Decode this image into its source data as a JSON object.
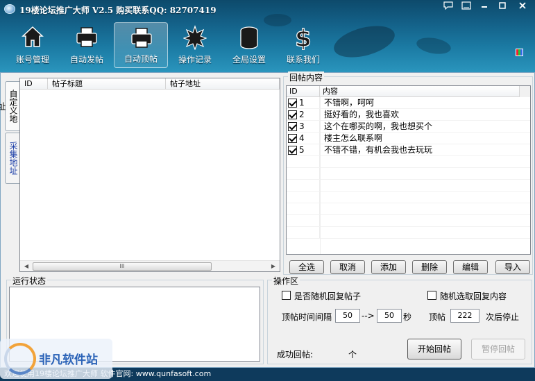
{
  "window": {
    "title": "19楼论坛推广大师 V2.5 购买联系QQ: 82707419",
    "controls": [
      "minimize-chat",
      "pin",
      "minimize",
      "maximize",
      "close"
    ]
  },
  "toolbar": {
    "items": [
      {
        "label": "账号管理",
        "icon": "house-icon",
        "active": false
      },
      {
        "label": "自动发帖",
        "icon": "printer-icon",
        "active": false
      },
      {
        "label": "自动顶帖",
        "icon": "printer-icon",
        "active": true
      },
      {
        "label": "操作记录",
        "icon": "starburst-icon",
        "active": false
      },
      {
        "label": "全局设置",
        "icon": "coin-stack-icon",
        "active": false
      },
      {
        "label": "联系我们",
        "icon": "dollar-icon",
        "active": false
      }
    ]
  },
  "left_panel": {
    "vertical_tabs": [
      "自定义地址",
      "采集地址"
    ],
    "columns": [
      "ID",
      "帖子标题",
      "帖子地址"
    ],
    "rows": [],
    "scroll_thumb_label": "III"
  },
  "reply_content": {
    "group_title": "回帖内容",
    "columns": [
      "ID",
      "内容"
    ],
    "rows": [
      {
        "checked": true,
        "id": "1",
        "content": "不错啊，呵呵"
      },
      {
        "checked": true,
        "id": "2",
        "content": "挺好看的，我也喜欢"
      },
      {
        "checked": true,
        "id": "3",
        "content": "这个在哪买的啊，我也想买个"
      },
      {
        "checked": true,
        "id": "4",
        "content": "楼主怎么联系啊"
      },
      {
        "checked": true,
        "id": "5",
        "content": "不错不错，有机会我也去玩玩"
      }
    ],
    "buttons": [
      "全选",
      "取消",
      "添加",
      "删除",
      "编辑",
      "导入"
    ]
  },
  "run_status": {
    "group_title": "运行状态"
  },
  "operation": {
    "group_title": "操作区",
    "random_reply_post_label": "是否随机回复帖子",
    "random_reply_content_label": "随机选取回复内容",
    "interval_label": "顶帖时间间隔",
    "interval_from": "50",
    "arrow": "-->",
    "interval_to": "50",
    "seconds_unit": "秒",
    "top_posts_label": "顶帖",
    "top_posts_value": "222",
    "stop_after_label": "次后停止",
    "success_label": "成功回帖:",
    "success_unit": "个",
    "start_button": "开始回帖",
    "pause_button": "暂停回帖"
  },
  "statusbar": {
    "text": "欢迎使用19楼论坛推广大师 软件官网: www.qunfasoft.com"
  },
  "watermark": {
    "text": "非凡软件站"
  },
  "colors": {
    "banner": "#135f86",
    "statusbar": "#0e3a5c",
    "vtab_active_text": "#1d3fa8"
  }
}
